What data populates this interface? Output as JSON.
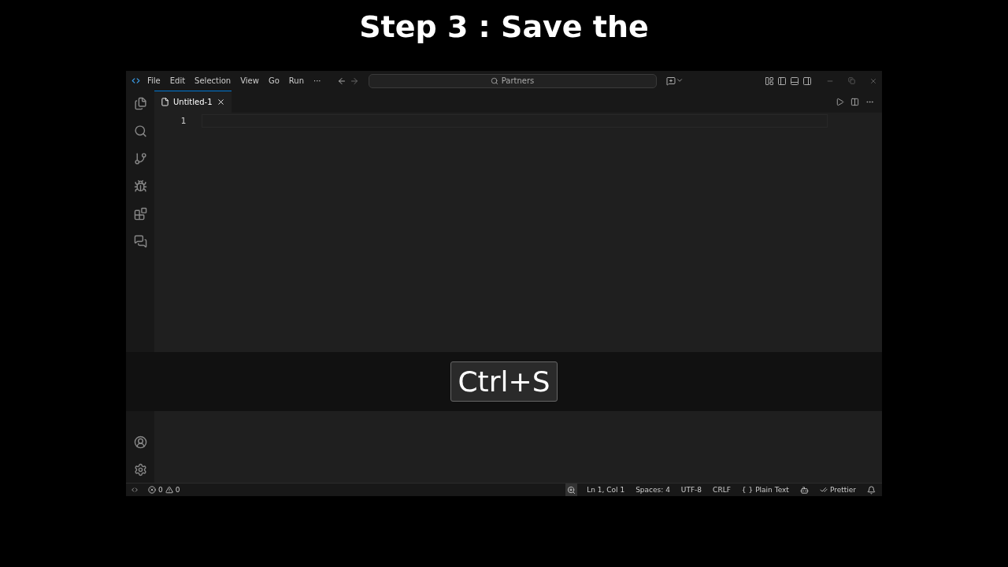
{
  "caption": "Step 3 : Save the",
  "menu": [
    "File",
    "Edit",
    "Selection",
    "View",
    "Go",
    "Run",
    "···"
  ],
  "command_center": {
    "text": "Partners"
  },
  "tabs": [
    {
      "label": "Untitled-1",
      "selected": true
    }
  ],
  "activity_bar": [
    {
      "kind": "files",
      "selected": false
    },
    {
      "kind": "search",
      "selected": false
    },
    {
      "kind": "scm",
      "selected": false
    },
    {
      "kind": "debug",
      "selected": false
    },
    {
      "kind": "extensions",
      "selected": false
    },
    {
      "kind": "chat",
      "selected": false
    }
  ],
  "editor": {
    "line_numbers": [
      "1"
    ]
  },
  "keystroke": "Ctrl+S",
  "status_bar": {
    "errors": "0",
    "warnings": "0",
    "items": [
      {
        "kind": "zoom"
      },
      {
        "kind": "text",
        "text": "Ln 1, Col 1"
      },
      {
        "kind": "text",
        "text": "Spaces: 4"
      },
      {
        "kind": "text",
        "text": "UTF-8"
      },
      {
        "kind": "text",
        "text": "CRLF"
      },
      {
        "kind": "lang",
        "icon": "{ }",
        "text": "Plain Text"
      },
      {
        "kind": "copilot"
      },
      {
        "kind": "prettier",
        "text": "Prettier"
      },
      {
        "kind": "bell"
      }
    ]
  }
}
